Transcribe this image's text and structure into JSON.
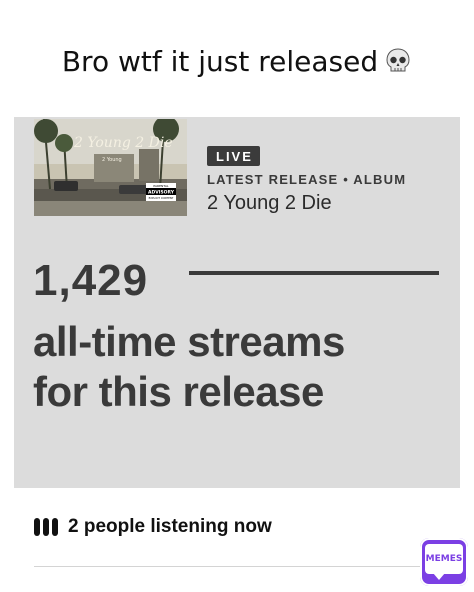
{
  "caption": {
    "text": "Bro wtf it just released",
    "emoji_icon": "skull-icon"
  },
  "release_card": {
    "badge": "LIVE",
    "meta": "LATEST RELEASE • ALBUM",
    "title": "2 Young 2 Die",
    "cover": {
      "script_title": "2 Young 2 Die",
      "artist_small": "2 Young",
      "advisory": "PARENTAL ADVISORY EXPLICIT CONTENT"
    },
    "stream_count": "1,429",
    "stream_label_line1": "all-time streams",
    "stream_label_line2": "for this release"
  },
  "listening": {
    "icon": "equalizer-bars-icon",
    "text": "2 people listening now"
  },
  "watermark": {
    "label": "MEMES"
  },
  "colors": {
    "card_bg": "#dcdcdc",
    "text_dark": "#3a3a3a",
    "badge_bg": "#3b3b3b",
    "watermark": "#7b3fe4"
  }
}
